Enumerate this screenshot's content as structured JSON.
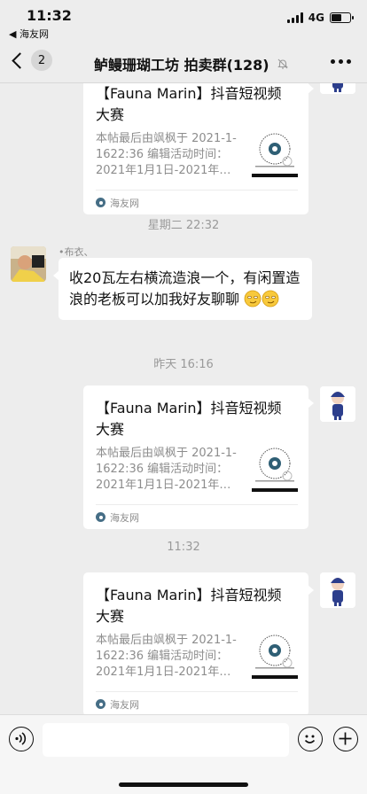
{
  "status": {
    "time": "11:32",
    "back_app": "◀ 海友网",
    "network": "4G",
    "battery_level": 0.55
  },
  "nav": {
    "unread_badge": "2",
    "title": "鲈鳗珊瑚工坊 拍卖群(128)",
    "mute_icon": "muted-bell-icon",
    "more_icon": "more-icon"
  },
  "card_template": {
    "title": "【Fauna Marin】抖音短视频大赛",
    "description": "本帖最后由飒枫于 2021-1-1622:36 编辑活动时间：2021年1月1日-2021年…",
    "source": "海友网"
  },
  "messages": [
    {
      "type": "card",
      "title": "【Fauna Marin】抖音短视频大赛",
      "description": "本帖最后由飒枫于 2021-1-1622:36 编辑活动时间：2021年1月1日-2021年…",
      "source": "海友网"
    },
    {
      "type": "timestamp",
      "text": "星期二 22:32"
    },
    {
      "type": "text",
      "sender": "•布衣、",
      "text": "收20瓦左右横流造浪一个，有闲置造浪的老板可以加我好友聊聊"
    },
    {
      "type": "timestamp",
      "text": "昨天 16:16"
    },
    {
      "type": "card",
      "title": "【Fauna Marin】抖音短视频大赛",
      "description": "本帖最后由飒枫于 2021-1-1622:36 编辑活动时间：2021年1月1日-2021年…",
      "source": "海友网"
    },
    {
      "type": "timestamp",
      "text": "11:32"
    },
    {
      "type": "card",
      "title": "【Fauna Marin】抖音短视频大赛",
      "description": "本帖最后由飒枫于 2021-1-1622:36 编辑活动时间：2021年1月1日-2021年…",
      "source": "海友网"
    }
  ],
  "input": {
    "voice_icon": "voice-icon",
    "emoji_icon": "emoji-icon",
    "add_icon": "plus-icon",
    "placeholder": ""
  }
}
